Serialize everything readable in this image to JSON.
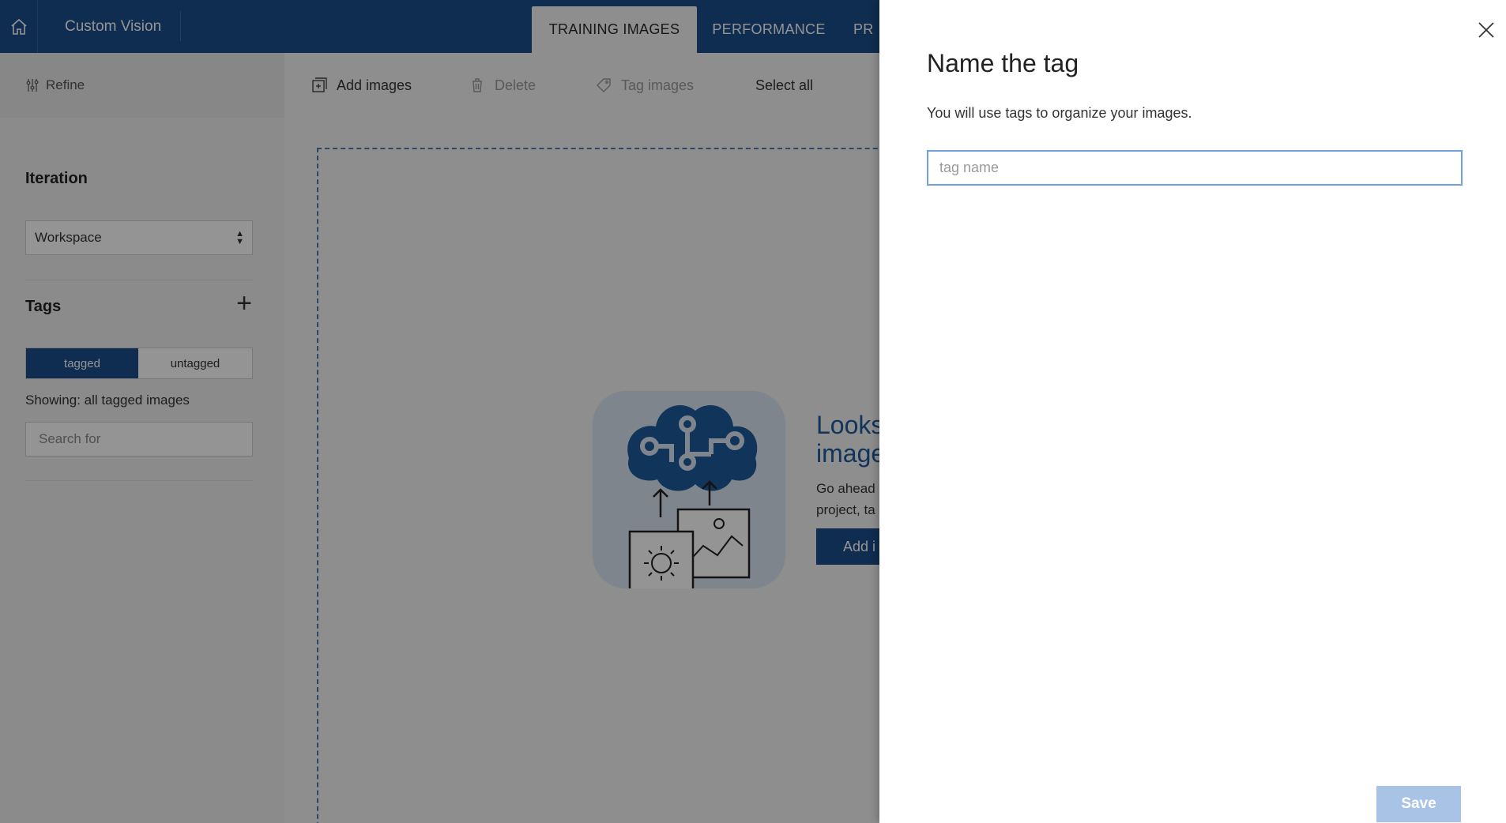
{
  "app": {
    "title": "Custom Vision"
  },
  "top_tabs": [
    {
      "label": "TRAINING IMAGES",
      "active": true
    },
    {
      "label": "PERFORMANCE",
      "active": false
    },
    {
      "label": "PR",
      "active": false
    }
  ],
  "sidebar": {
    "refine_label": "Refine",
    "iteration_heading": "Iteration",
    "iteration_select_value": "Workspace",
    "tags_heading": "Tags",
    "toggle": {
      "tagged": "tagged",
      "untagged": "untagged",
      "selected": "tagged"
    },
    "showing_text": "Showing: all tagged images",
    "search_placeholder": "Search for"
  },
  "toolbar": {
    "add_images": "Add images",
    "delete": "Delete",
    "tag_images": "Tag images",
    "select_all": "Select all"
  },
  "empty_state": {
    "title_line1": "Looks",
    "title_line2": "image",
    "desc_line1": "Go ahead",
    "desc_line2": "project, ta",
    "add_button": "Add i"
  },
  "tag_panel": {
    "title": "Name the tag",
    "description": "You will use tags to organize your images.",
    "input_placeholder": "tag name",
    "input_value": "",
    "save_label": "Save"
  },
  "colors": {
    "brand_blue": "#1b4f8a",
    "accent_focus": "#6fa2dc",
    "save_disabled": "#a8c3e6"
  },
  "icons": {
    "home": "home-icon",
    "refine": "sliders-icon",
    "add_images": "add-image-icon",
    "delete": "trash-icon",
    "tag": "tag-icon",
    "close": "close-icon",
    "plus": "plus-icon"
  }
}
